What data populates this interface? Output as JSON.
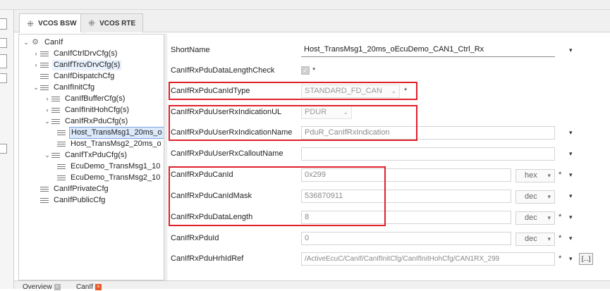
{
  "tabs": [
    {
      "label": "VCOS BSW",
      "icon": "cursor-click-icon"
    },
    {
      "label": "VCOS RTE",
      "icon": "cursor-click-icon"
    }
  ],
  "tree": [
    {
      "label": "CanIf",
      "expanded": true,
      "icon": "gear-icon"
    },
    {
      "label": "CanIfCtrlDrvCfg(s)",
      "expanded": false
    },
    {
      "label": "CanIfTrcvDrvCfg(s)",
      "expanded": false
    },
    {
      "label": "CanIfDispatchCfg"
    },
    {
      "label": "CanIfInitCfg",
      "expanded": true
    },
    {
      "label": "CanIfBufferCfg(s)",
      "expanded": false
    },
    {
      "label": "CanIfInitHohCfg(s)",
      "expanded": false
    },
    {
      "label": "CanIfRxPduCfg(s)",
      "expanded": true
    },
    {
      "label": "Host_TransMsg1_20ms_o"
    },
    {
      "label": "Host_TransMsg2_20ms_o"
    },
    {
      "label": "CanIfTxPduCfg(s)",
      "expanded": true
    },
    {
      "label": "EcuDemo_TransMsg1_10"
    },
    {
      "label": "EcuDemo_TransMsg2_10"
    },
    {
      "label": "CanIfPrivateCfg"
    },
    {
      "label": "CanIfPublicCfg"
    }
  ],
  "props": {
    "short_name": {
      "label": "ShortName",
      "value": "Host_TransMsg1_20ms_oEcuDemo_CAN1_Ctrl_Rx"
    },
    "dlc_check": {
      "label": "CanIfRxPduDataLengthCheck",
      "checked": true,
      "required": "*"
    },
    "can_id_type": {
      "label": "CanIfRxPduCanIdType",
      "value": "STANDARD_FD_CAN",
      "required": "*"
    },
    "user_rx_ind_ul": {
      "label": "CanIfRxPduUserRxIndicationUL",
      "value": "PDUR"
    },
    "user_rx_ind_name": {
      "label": "CanIfRxPduUserRxIndicationName",
      "value": "PduR_CanIfRxIndication"
    },
    "user_rx_callout": {
      "label": "CanIfRxPduUserRxCalloutName",
      "value": ""
    },
    "can_id": {
      "label": "CanIfRxPduCanId",
      "value": "0x299",
      "radix": "hex",
      "required": "*"
    },
    "can_id_mask": {
      "label": "CanIfRxPduCanIdMask",
      "value": "536870911",
      "radix": "dec"
    },
    "data_length": {
      "label": "CanIfRxPduDataLength",
      "value": "8",
      "radix": "dec",
      "required": "*"
    },
    "pdu_id": {
      "label": "CanIfRxPduId",
      "value": "0",
      "radix": "dec",
      "required": "*"
    },
    "hrh_id_ref": {
      "label": "CanIfRxPduHrhIdRef",
      "value": "/ActiveEcuC/CanIf/CanIfInitCfg/CanIfInitHohCfg/CAN1RX_299",
      "required": "*",
      "browse": "[...]"
    }
  },
  "bottom_tabs": [
    {
      "label": "Overview"
    },
    {
      "label": "CanIf"
    }
  ],
  "colors": {
    "highlight_box": "#e0202a",
    "selection": "#dbe9fb"
  }
}
